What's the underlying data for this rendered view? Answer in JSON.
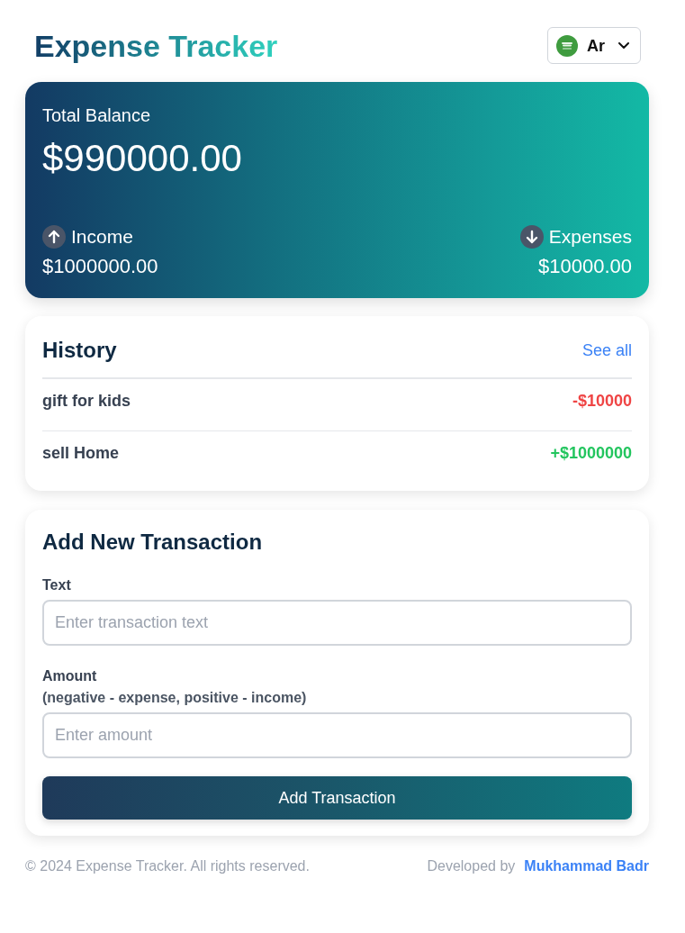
{
  "header": {
    "title": "Expense Tracker",
    "language": {
      "label": "Ar"
    }
  },
  "balance": {
    "label": "Total Balance",
    "amount": "$990000.00",
    "summary": [
      {
        "kind": "income",
        "label": "Income",
        "amount": "$1000000.00"
      },
      {
        "kind": "expense",
        "label": "Expenses",
        "amount": "$10000.00"
      }
    ]
  },
  "history": {
    "title": "History",
    "link": "See all",
    "transactions": [
      {
        "kind": "expense",
        "text": "gift for kids",
        "amount": "-$10000"
      },
      {
        "kind": "income",
        "text": "sell Home",
        "amount": "+$1000000"
      }
    ]
  },
  "form": {
    "title": "Add New Transaction",
    "fields": [
      {
        "label": "Text",
        "placeholder": "Enter transaction text"
      },
      {
        "label": "Amount",
        "hint": "(negative - expense, positive - income)",
        "placeholder": "Enter amount"
      }
    ],
    "button": "Add Transaction"
  },
  "footer": {
    "copyright": "© 2024 Expense Tracker. All rights reserved.",
    "credit": "Developed by",
    "author": "Mukhammad Badr"
  }
}
